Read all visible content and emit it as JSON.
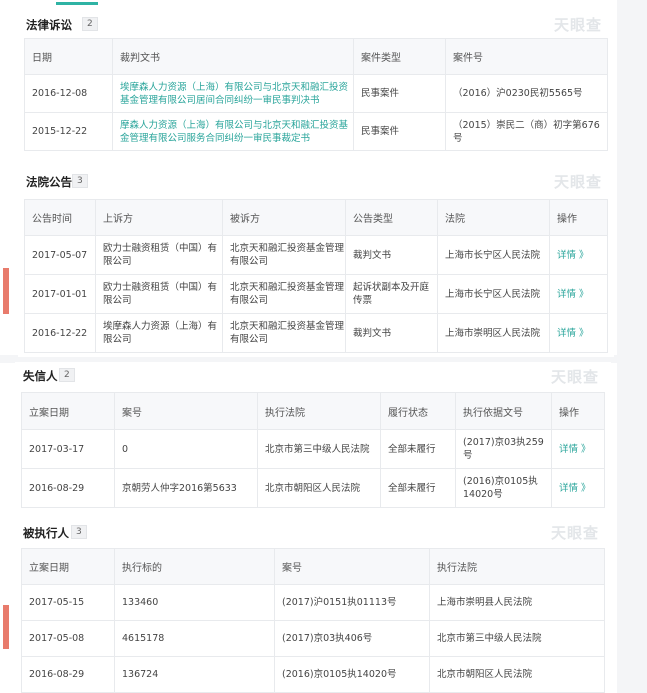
{
  "brand": "天眼查",
  "lawsuits": {
    "title": "法律诉讼",
    "count": "2",
    "columns": [
      "日期",
      "裁判文书",
      "案件类型",
      "案件号"
    ],
    "rows": [
      {
        "date": "2016-12-08",
        "doc": "埃摩森人力资源（上海）有限公司与北京天和融汇投资基金管理有限公司居间合同纠纷一审民事判决书",
        "type": "民事案件",
        "no": "（2016）沪0230民初5565号"
      },
      {
        "date": "2015-12-22",
        "doc": "摩森人力资源（上海）有限公司与北京天和融汇投资基金管理有限公司服务合同纠纷一审民事裁定书",
        "type": "民事案件",
        "no": "（2015）崇民二（商）初字第676号"
      }
    ]
  },
  "notices": {
    "title": "法院公告",
    "count": "3",
    "columns": [
      "公告时间",
      "上诉方",
      "被诉方",
      "公告类型",
      "法院",
      "操作"
    ],
    "rows": [
      {
        "date": "2017-05-07",
        "appellant": "欧力士融资租赁（中国）有限公司",
        "respondent": "北京天和融汇投资基金管理有限公司",
        "type": "裁判文书",
        "court": "上海市长宁区人民法院",
        "action": "详情 》"
      },
      {
        "date": "2017-01-01",
        "appellant": "欧力士融资租赁（中国）有限公司",
        "respondent": "北京天和融汇投资基金管理有限公司",
        "type": "起诉状副本及开庭传票",
        "court": "上海市长宁区人民法院",
        "action": "详情 》"
      },
      {
        "date": "2016-12-22",
        "appellant": "埃摩森人力资源（上海）有限公司",
        "respondent": "北京天和融汇投资基金管理有限公司",
        "type": "裁判文书",
        "court": "上海市崇明区人民法院",
        "action": "详情 》"
      }
    ]
  },
  "dishonest": {
    "title": "失信人",
    "count": "2",
    "columns": [
      "立案日期",
      "案号",
      "执行法院",
      "履行状态",
      "执行依据文号",
      "操作"
    ],
    "rows": [
      {
        "date": "2017-03-17",
        "case": "0",
        "court": "北京市第三中级人民法院",
        "status": "全部未履行",
        "basis": "(2017)京03执259号",
        "action": "详情 》"
      },
      {
        "date": "2016-08-29",
        "case": "京朝劳人仲字2016第5633",
        "court": "北京市朝阳区人民法院",
        "status": "全部未履行",
        "basis": "(2016)京0105执14020号",
        "action": "详情 》"
      }
    ]
  },
  "executed": {
    "title": "被执行人",
    "count": "3",
    "columns": [
      "立案日期",
      "执行标的",
      "案号",
      "执行法院"
    ],
    "rows": [
      {
        "date": "2017-05-15",
        "amount": "133460",
        "case": "(2017)沪0151执01113号",
        "court": "上海市崇明县人民法院"
      },
      {
        "date": "2017-05-08",
        "amount": "4615178",
        "case": "(2017)京03执406号",
        "court": "北京市第三中级人民法院"
      },
      {
        "date": "2016-08-29",
        "amount": "136724",
        "case": "(2016)京0105执14020号",
        "court": "北京市朝阳区人民法院"
      }
    ]
  }
}
